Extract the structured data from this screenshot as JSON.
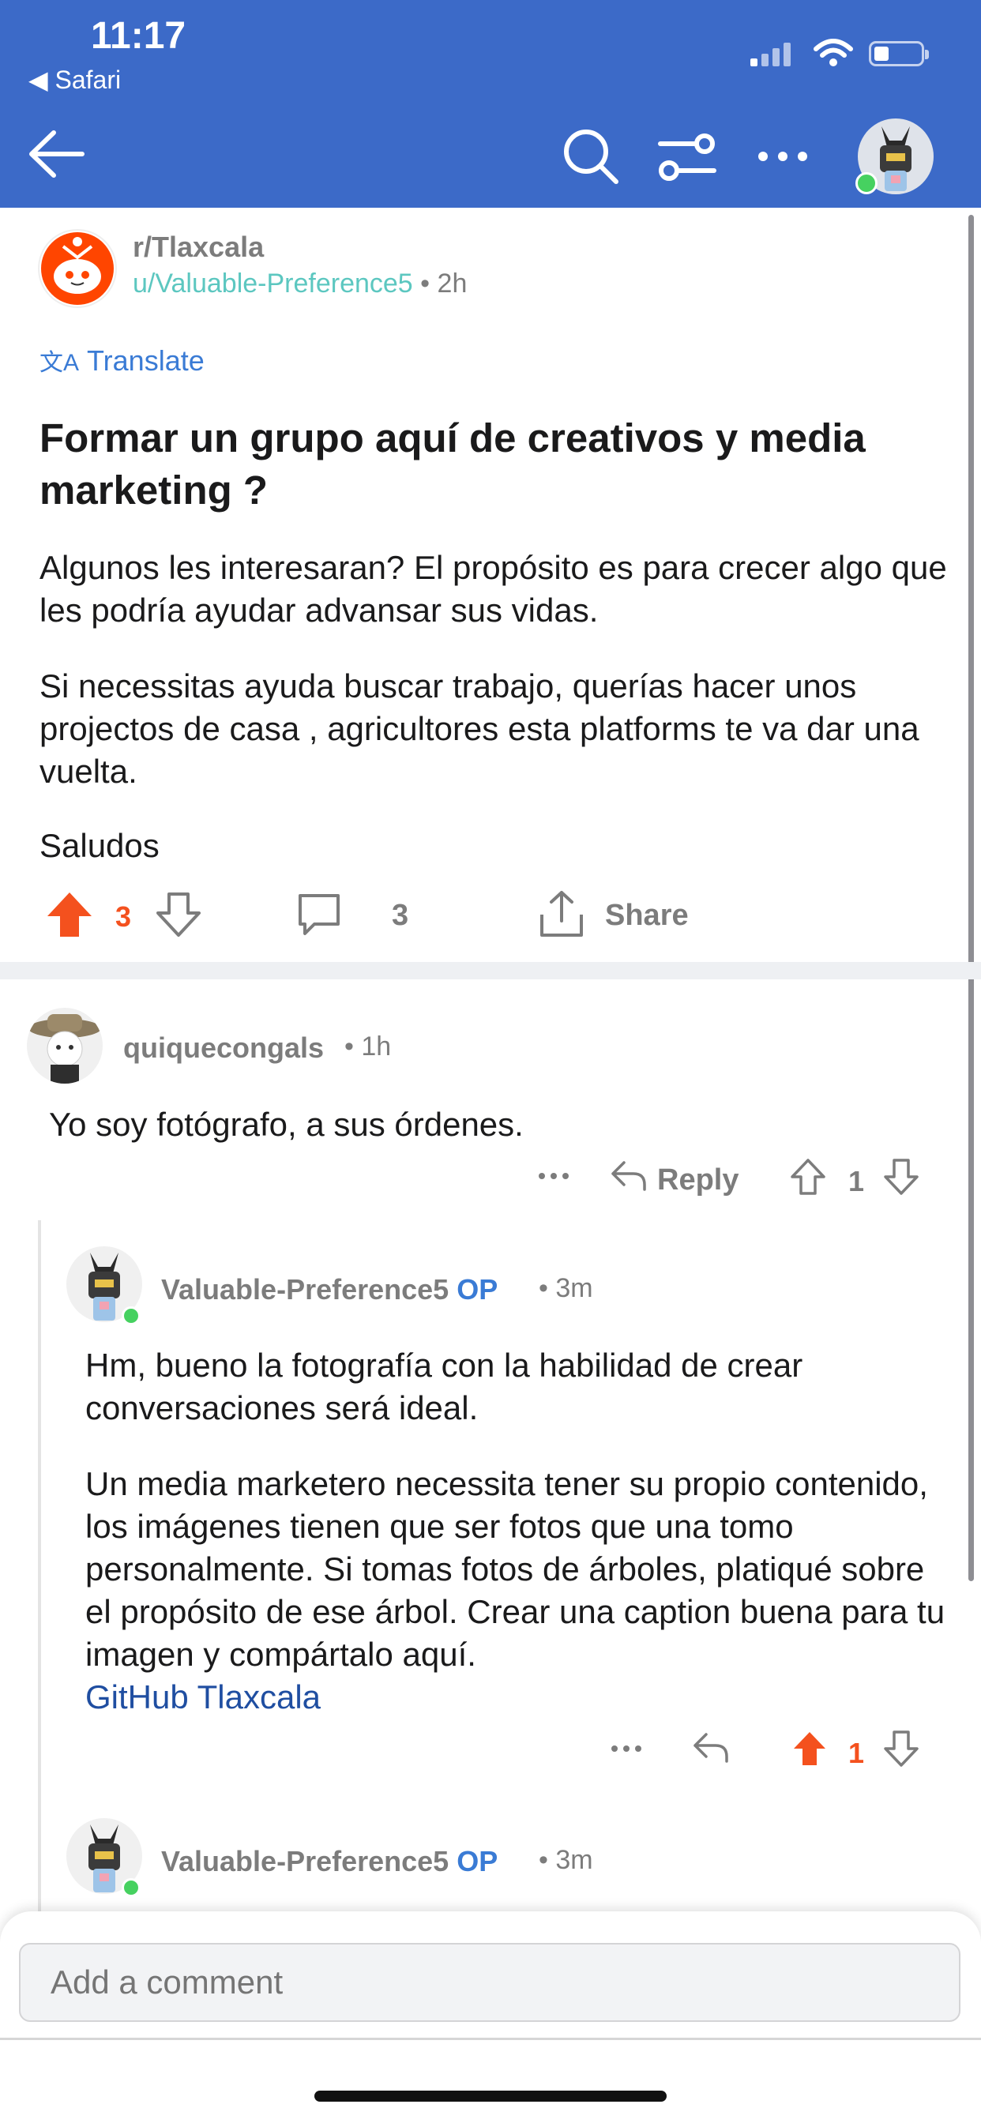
{
  "status_bar": {
    "time": "11:17",
    "back_app": "◀ Safari"
  },
  "nav": {
    "back_icon": "arrow-left-icon",
    "search_icon": "search-icon",
    "sort_icon": "sort-icon",
    "more_icon": "more-icon"
  },
  "post": {
    "subreddit": "r/Tlaxcala",
    "author": "u/Valuable-Preference5",
    "age": "2h",
    "translate": "Translate",
    "title": "Formar un grupo aquí de creativos y media marketing ?",
    "body": [
      "Algunos les interesaran? El propósito es para crecer algo que les podría ayudar advansar  sus vidas.",
      "Si necessitas ayuda buscar trabajo, querías hacer unos projectos de casa , agricultores esta platforms te va dar una vuelta.",
      "Saludos"
    ],
    "votes": "3",
    "comments": "3",
    "share": "Share"
  },
  "comments": [
    {
      "user": "quiquecongals",
      "age": "1h",
      "body": "Yo soy fotógrafo, a sus órdenes.",
      "reply": "Reply",
      "votes": "1"
    },
    {
      "user": "Valuable-Preference5",
      "op": "OP",
      "age": "3m",
      "body1": "Hm, bueno la fotografía con la habilidad de crear conversaciones será ideal.",
      "body2": "Un media marketero necessita tener su propio contenido, los imágenes tienen que ser fotos que una tomo personalmente. Si tomas fotos de árboles, platiqué sobre el propósito de ese árbol. Crear una caption buena para tu imagen y compártalo aquí.",
      "link": "GitHub Tlaxcala",
      "votes": "1"
    },
    {
      "user": "Valuable-Preference5",
      "op": "OP",
      "age": "3m"
    }
  ],
  "composer": {
    "placeholder": "Add a comment"
  },
  "colors": {
    "header": "#3c6ac8",
    "upvote": "#f4511e",
    "link": "#3a7bd5",
    "online": "#46d160"
  }
}
